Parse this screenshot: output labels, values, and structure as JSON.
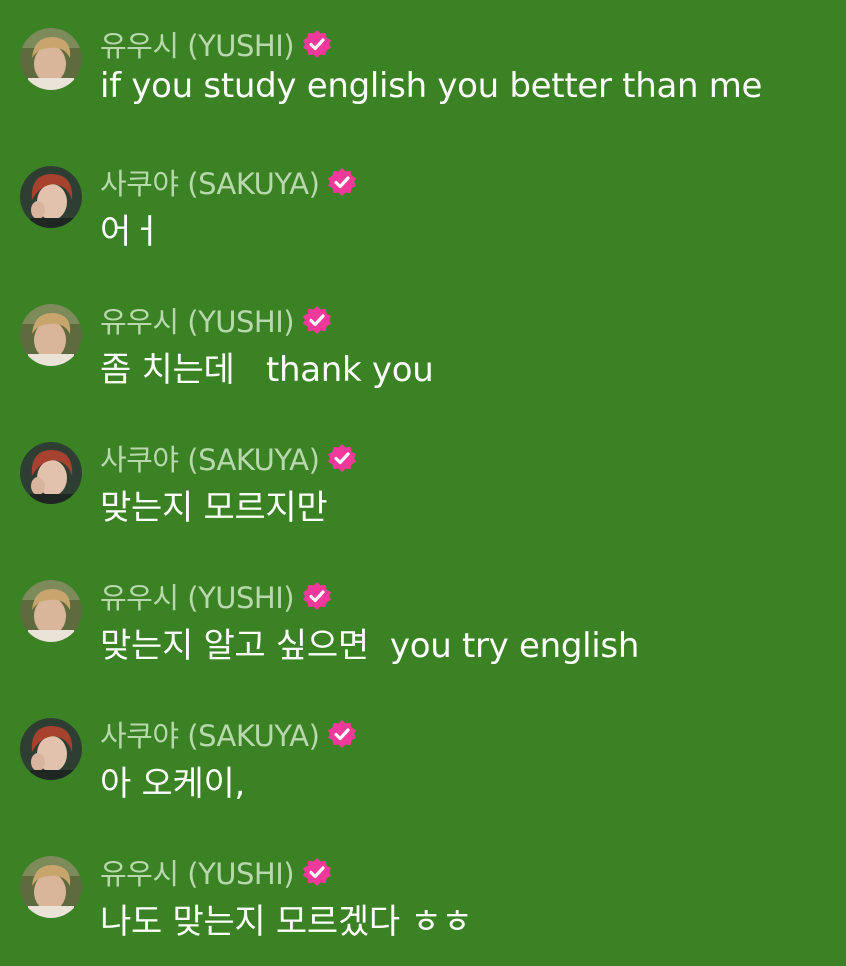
{
  "colors": {
    "background": "#3a8224",
    "username": "#b9d8ad",
    "message_text": "#ffffff",
    "verified_badge": "#f2389b"
  },
  "messages": [
    {
      "user": "유우시 (YUSHI)",
      "avatar": "yushi-avatar",
      "verified": true,
      "text": "if you study english you better than me"
    },
    {
      "user": "사쿠야 (SAKUYA)",
      "avatar": "sakuya-avatar",
      "verified": true,
      "text": "어ㅓ"
    },
    {
      "user": "유우시 (YUSHI)",
      "avatar": "yushi-avatar",
      "verified": true,
      "text": "좀 치는데   thank you"
    },
    {
      "user": "사쿠야 (SAKUYA)",
      "avatar": "sakuya-avatar",
      "verified": true,
      "text": "맞는지 모르지만"
    },
    {
      "user": "유우시 (YUSHI)",
      "avatar": "yushi-avatar",
      "verified": true,
      "text": "맞는지 알고 싶으면  you try english"
    },
    {
      "user": "사쿠야 (SAKUYA)",
      "avatar": "sakuya-avatar",
      "verified": true,
      "text": "아 오케이,"
    },
    {
      "user": "유우시 (YUSHI)",
      "avatar": "yushi-avatar",
      "verified": true,
      "text": "나도 맞는지 모르겠다 ㅎㅎ"
    }
  ]
}
